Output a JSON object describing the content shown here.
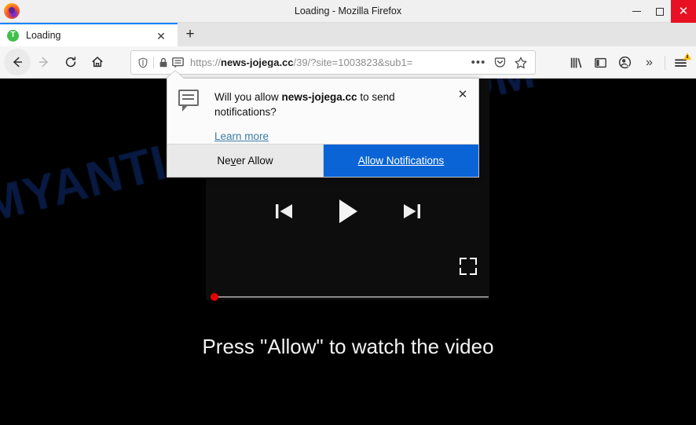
{
  "window": {
    "title": "Loading - Mozilla Firefox",
    "controls": {
      "minimize": "—",
      "maximize": "□",
      "close": "✕"
    }
  },
  "tabs": {
    "active": {
      "favicon_letter": "T",
      "label": "Loading",
      "close_glyph": "✕"
    },
    "new_tab_glyph": "+"
  },
  "nav": {
    "back": "back-arrow",
    "forward": "forward-arrow",
    "reload": "reload-arrow",
    "home": "home-house"
  },
  "urlbar": {
    "shield_icon": "shield-icon",
    "lock_icon": "padlock-icon",
    "notification_icon": "speech-bubble-icon",
    "scheme": "https://",
    "host": "news-jojega.cc",
    "path": "/39/?site=1003823&sub1=",
    "full_url": "https://news-jojega.cc/39/?site=1003823&sub1=",
    "page_actions_glyph": "•••",
    "pocket_icon": "pocket-icon",
    "bookmark_icon": "star-icon"
  },
  "toolbar_right": {
    "library_icon": "library-icon",
    "sidebar_icon": "sidebar-icon",
    "account_icon": "account-sync-icon",
    "overflow_glyph": "»",
    "menu_icon": "hamburger-menu-icon",
    "menu_badge": "warning-triangle-badge"
  },
  "popup": {
    "icon": "speech-bubble-icon",
    "question_prefix": "Will you allow ",
    "question_host": "news-jojega.cc",
    "question_suffix": " to send notifications?",
    "learn_more": "Learn more",
    "close_glyph": "✕",
    "never_allow_pre": "Ne",
    "never_allow_key": "v",
    "never_allow_post": "er Allow",
    "allow_key": "A",
    "allow_post": "llow Notifications"
  },
  "page": {
    "watermark": "MYANTISPYWARE.COM",
    "press_text": "Press \"Allow\" to watch the video",
    "player": {
      "previous_icon": "skip-previous-icon",
      "play_icon": "play-icon",
      "next_icon": "skip-next-icon",
      "fullscreen_icon": "fullscreen-icon",
      "progress_percent": 0
    },
    "background_color": "#000000",
    "accent_color": "#0a64d6",
    "watermark_color": "#0e2a6b"
  }
}
